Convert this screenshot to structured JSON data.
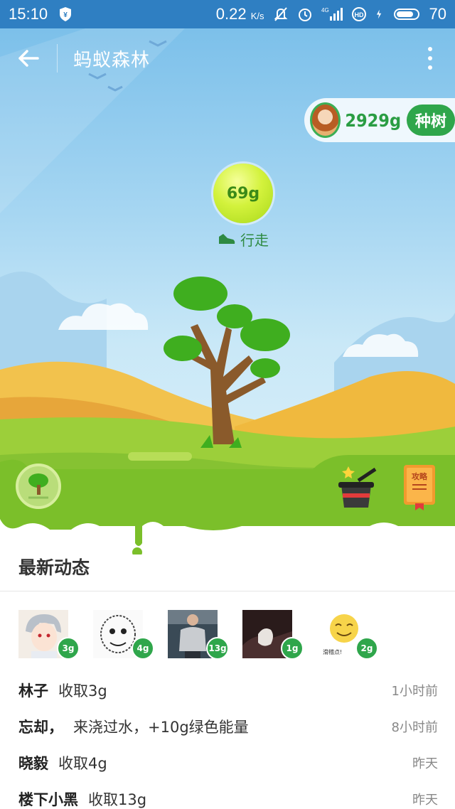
{
  "status_bar": {
    "time": "15:10",
    "speed": "0.22",
    "speed_unit": "K/s",
    "network": "4G",
    "battery": "70",
    "icons": [
      "shield-yen-icon",
      "mute-icon",
      "alarm-icon",
      "signal-icon",
      "hd-icon",
      "charging-icon",
      "battery-icon"
    ]
  },
  "header": {
    "title": "蚂蚁森林",
    "back_icon": "arrow-left-icon",
    "more_icon": "more-vertical-icon"
  },
  "energy": {
    "total": "2929g",
    "plant_label": "种树",
    "ball_value": "69g",
    "ball_source": "行走"
  },
  "feed": {
    "title": "最新动态",
    "friends": [
      {
        "badge": "3g",
        "avatar": "anime-boy-avatar"
      },
      {
        "badge": "4g",
        "avatar": "meme-face-avatar"
      },
      {
        "badge": "13g",
        "avatar": "person-photo-avatar"
      },
      {
        "badge": "1g",
        "avatar": "hand-photo-avatar"
      },
      {
        "badge": "2g",
        "avatar": "emoji-face-avatar",
        "caption": "滑稽点!"
      }
    ],
    "items": [
      {
        "name": "林子",
        "action": "收取3g",
        "time": "1小时前"
      },
      {
        "name": "忘却，",
        "action": "来浇过水，+10g绿色能量",
        "time": "8小时前"
      },
      {
        "name": "晓毅",
        "action": "收取4g",
        "time": "昨天"
      },
      {
        "name": "楼下小黑",
        "action": "收取13g",
        "time": "昨天"
      }
    ]
  },
  "colors": {
    "status_bar": "#2f7fc2",
    "accent_green": "#2fa64b",
    "grass": "#7bbf2a"
  }
}
